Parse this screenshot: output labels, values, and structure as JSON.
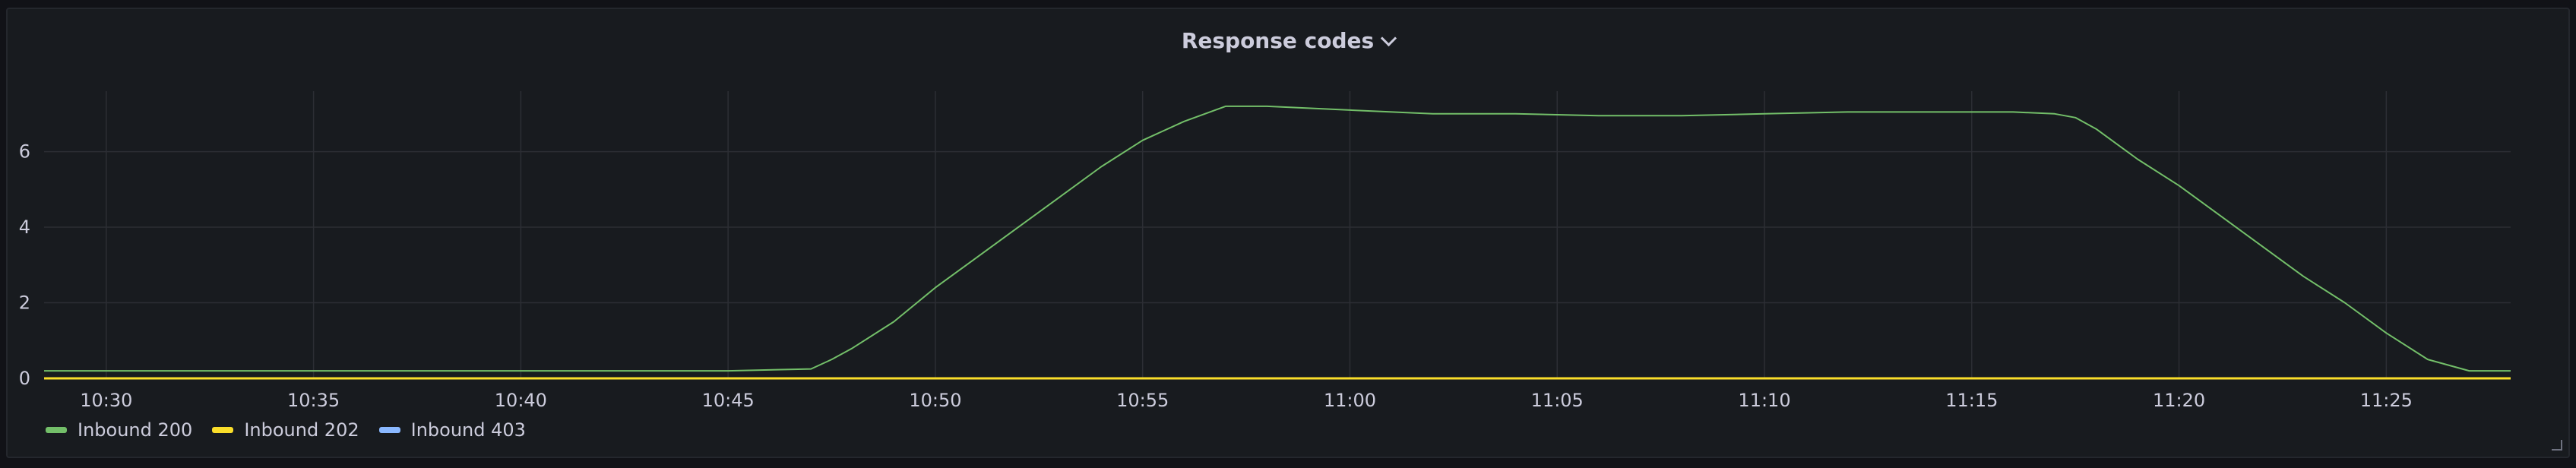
{
  "panel": {
    "title": "Response codes",
    "menu_icon": "chevron-down-icon"
  },
  "colors": {
    "background": "#181b1f",
    "grid": "#2c2e34",
    "text": "#ccccdc"
  },
  "chart_data": {
    "type": "line",
    "title": "Response codes",
    "xlabel": "",
    "ylabel": "",
    "x_ticks": [
      "10:30",
      "10:35",
      "10:40",
      "10:45",
      "10:50",
      "10:55",
      "11:00",
      "11:05",
      "11:10",
      "11:15",
      "11:20",
      "11:25"
    ],
    "xlim": [
      "10:28:30",
      "11:28:00"
    ],
    "ylim": [
      0,
      7.6
    ],
    "y_ticks": [
      0,
      2,
      4,
      6
    ],
    "grid": true,
    "legend_position": "bottom-left",
    "series": [
      {
        "name": "Inbound 200",
        "color": "#73bf69",
        "x": [
          "10:28:30",
          "10:45:00",
          "10:47:00",
          "10:47:30",
          "10:48:00",
          "10:49:00",
          "10:50:00",
          "10:51:00",
          "10:52:00",
          "10:53:00",
          "10:54:00",
          "10:55:00",
          "10:56:00",
          "10:57:00",
          "10:58:00",
          "11:00:00",
          "11:02:00",
          "11:04:00",
          "11:06:00",
          "11:08:00",
          "11:10:00",
          "11:12:00",
          "11:14:00",
          "11:16:00",
          "11:17:00",
          "11:17:30",
          "11:18:00",
          "11:19:00",
          "11:20:00",
          "11:21:00",
          "11:22:00",
          "11:23:00",
          "11:24:00",
          "11:25:00",
          "11:26:00",
          "11:27:00",
          "11:28:00"
        ],
        "y": [
          0.2,
          0.2,
          0.25,
          0.5,
          0.8,
          1.5,
          2.4,
          3.2,
          4.0,
          4.8,
          5.6,
          6.3,
          6.8,
          7.2,
          7.2,
          7.1,
          7.0,
          7.0,
          6.95,
          6.95,
          7.0,
          7.05,
          7.05,
          7.05,
          7.0,
          6.9,
          6.6,
          5.8,
          5.1,
          4.3,
          3.5,
          2.7,
          2.0,
          1.2,
          0.5,
          0.2,
          0.2
        ]
      },
      {
        "name": "Inbound 202",
        "color": "#fade2a",
        "x": [
          "10:28:30",
          "11:28:00"
        ],
        "y": [
          0,
          0
        ]
      },
      {
        "name": "Inbound 403",
        "color": "#8ab8ff",
        "x": [
          "10:28:30",
          "11:28:00"
        ],
        "y": [
          0,
          0
        ]
      }
    ]
  }
}
